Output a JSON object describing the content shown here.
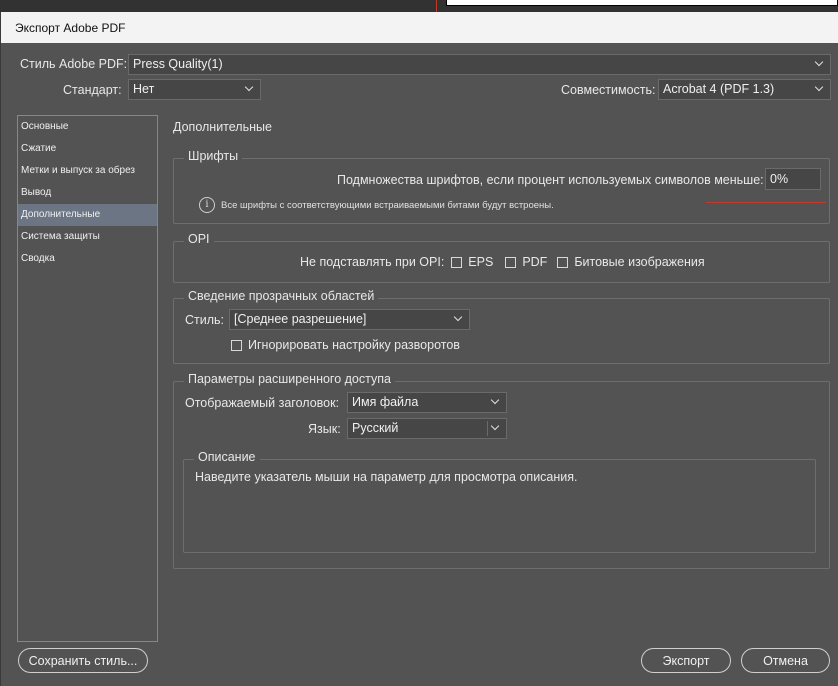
{
  "window": {
    "title": "Экспорт Adobe PDF"
  },
  "top": {
    "style_label": "Стиль Adobe PDF:",
    "style_value": "Press Quality(1)",
    "standard_label": "Стандарт:",
    "standard_value": "Нет",
    "compat_label": "Совместимость:",
    "compat_value": "Acrobat 4 (PDF 1.3)"
  },
  "sidebar": {
    "items": [
      {
        "label": "Основные"
      },
      {
        "label": "Сжатие"
      },
      {
        "label": "Метки и выпуск за обрез"
      },
      {
        "label": "Вывод"
      },
      {
        "label": "Дополнительные",
        "active": true
      },
      {
        "label": "Система защиты"
      },
      {
        "label": "Сводка"
      }
    ]
  },
  "main": {
    "title": "Дополнительные",
    "fonts": {
      "title": "Шрифты",
      "subset_label": "Подмножества шрифтов, если процент используемых символов меньше:",
      "subset_value": "0%",
      "note": "Все шрифты с соответствующими встраиваемыми битами будут встроены."
    },
    "opi": {
      "title": "OPI",
      "omit_label": "Не подставлять при OPI:",
      "eps": "EPS",
      "pdf": "PDF",
      "bitmap": "Битовые изображения"
    },
    "transparency": {
      "title": "Сведение прозрачных областей",
      "style_label": "Стиль:",
      "style_value": "[Среднее разрешение]",
      "ignore_label": "Игнорировать настройку разворотов"
    },
    "accessibility": {
      "title": "Параметры расширенного доступа",
      "display_title_label": "Отображаемый заголовок:",
      "display_title_value": "Имя файла",
      "language_label": "Язык:",
      "language_value": "Русский"
    },
    "description": {
      "title": "Описание",
      "text": "Наведите указатель мыши на параметр для просмотра описания."
    }
  },
  "footer": {
    "save_style": "Сохранить стиль...",
    "export": "Экспорт",
    "cancel": "Отмена"
  },
  "colors": {
    "accent": "#5a8fd0",
    "dialog_bg": "#535353",
    "active_item": "#6b7584",
    "marker": "#c0392b"
  }
}
